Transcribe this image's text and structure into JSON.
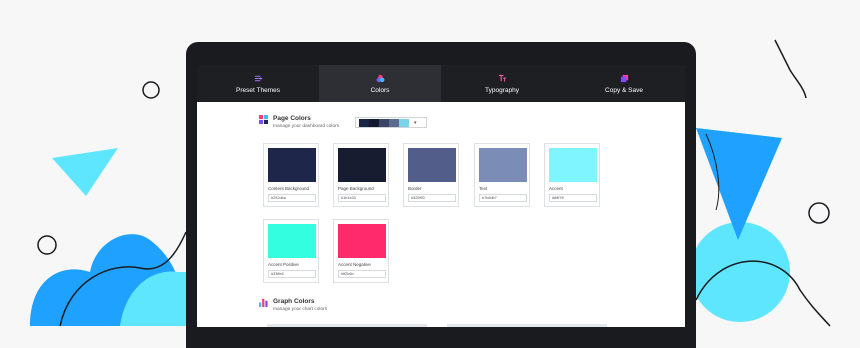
{
  "nav": {
    "tabs": [
      {
        "label": "Preset Themes",
        "icon": "list-arrow-icon",
        "color": "#b07cff"
      },
      {
        "label": "Colors",
        "icon": "color-circles-icon",
        "color": "#ff3b7a"
      },
      {
        "label": "Typography",
        "icon": "type-icon",
        "color": "#ff5ba8"
      },
      {
        "label": "Copy & Save",
        "icon": "copy-icon",
        "color": "#a44cff"
      }
    ],
    "active_tab": "Colors"
  },
  "page_colors": {
    "title": "Page Colors",
    "subtitle": "manage your dashboard colors",
    "palette_swatches": [
      "#1b2444",
      "#131a2e",
      "#3a4566",
      "#5a6b8f",
      "#7bd4e6"
    ],
    "cards": [
      {
        "label": "Content Background",
        "hex": "#252d4a",
        "color": "#1e2749"
      },
      {
        "label": "Page Background",
        "hex": "#1b1e33",
        "color": "#171c30"
      },
      {
        "label": "Border",
        "hex": "#525f90",
        "color": "#525d8a"
      },
      {
        "label": "Text",
        "hex": "#7b8db7",
        "color": "#7b8db7"
      },
      {
        "label": "Accent",
        "hex": "#88f7ff",
        "color": "#7ff5ff"
      },
      {
        "label": "Accent Positive",
        "hex": "#33ffe6",
        "color": "#33ffe0"
      },
      {
        "label": "Accent Negative",
        "hex": "#ff2b6b",
        "color": "#ff2a6b"
      }
    ]
  },
  "graph_colors": {
    "title": "Graph Colors",
    "subtitle": "manage your chart colors"
  },
  "colors": {
    "background": "#f7f7f8",
    "laptop": "#1a1b1f",
    "nav": "#1e1f23",
    "deco_blue": "#1fa2ff",
    "deco_cyan": "#5fe6ff"
  }
}
